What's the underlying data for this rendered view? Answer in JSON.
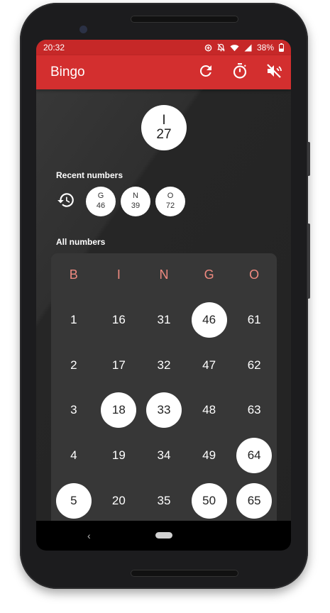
{
  "status_bar": {
    "time": "20:32",
    "battery": "38%"
  },
  "app_bar": {
    "title": "Bingo",
    "actions": [
      "refresh-icon",
      "timer-icon",
      "volume-off-icon"
    ]
  },
  "current_number": {
    "letter": "I",
    "number": "27"
  },
  "recent": {
    "label": "Recent numbers",
    "items": [
      {
        "letter": "G",
        "number": "46"
      },
      {
        "letter": "N",
        "number": "39"
      },
      {
        "letter": "O",
        "number": "72"
      }
    ]
  },
  "all_numbers": {
    "label": "All numbers",
    "columns": [
      "B",
      "I",
      "N",
      "G",
      "O"
    ],
    "rows": [
      [
        {
          "n": "1",
          "drawn": false
        },
        {
          "n": "16",
          "drawn": false
        },
        {
          "n": "31",
          "drawn": false
        },
        {
          "n": "46",
          "drawn": true
        },
        {
          "n": "61",
          "drawn": false
        }
      ],
      [
        {
          "n": "2",
          "drawn": false
        },
        {
          "n": "17",
          "drawn": false
        },
        {
          "n": "32",
          "drawn": false
        },
        {
          "n": "47",
          "drawn": false
        },
        {
          "n": "62",
          "drawn": false
        }
      ],
      [
        {
          "n": "3",
          "drawn": false
        },
        {
          "n": "18",
          "drawn": true
        },
        {
          "n": "33",
          "drawn": true
        },
        {
          "n": "48",
          "drawn": false
        },
        {
          "n": "63",
          "drawn": false
        }
      ],
      [
        {
          "n": "4",
          "drawn": false
        },
        {
          "n": "19",
          "drawn": false
        },
        {
          "n": "34",
          "drawn": false
        },
        {
          "n": "49",
          "drawn": false
        },
        {
          "n": "64",
          "drawn": true
        }
      ],
      [
        {
          "n": "5",
          "drawn": true
        },
        {
          "n": "20",
          "drawn": false
        },
        {
          "n": "35",
          "drawn": false
        },
        {
          "n": "50",
          "drawn": true
        },
        {
          "n": "65",
          "drawn": true
        }
      ]
    ]
  },
  "nav": {
    "back_glyph": "‹"
  },
  "colors": {
    "status_bar": "#c62828",
    "app_bar": "#d32f2f",
    "column_header": "#ef8a80",
    "board_background": "#373737",
    "screen_background": "#262626"
  }
}
